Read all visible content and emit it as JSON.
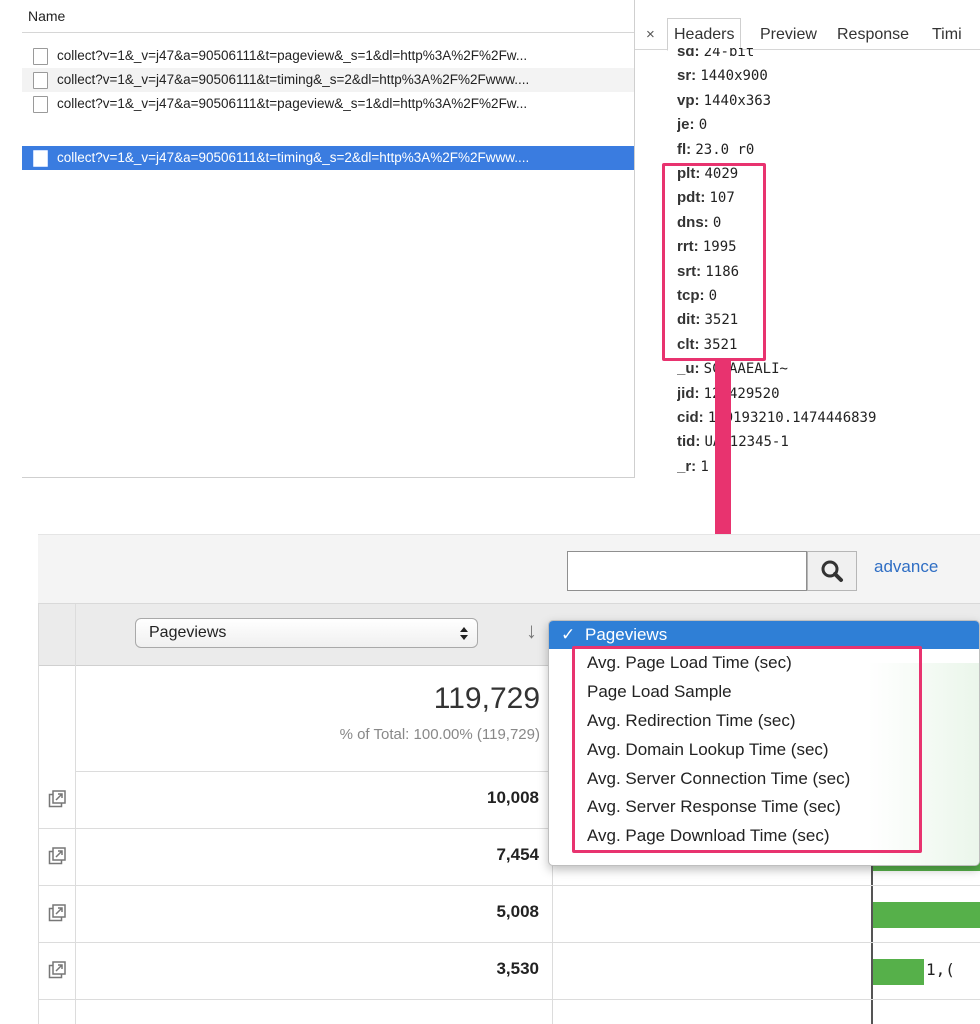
{
  "devtools": {
    "list_header": "Name",
    "requests": [
      {
        "name": "collect?v=1&_v=j47&a=90506111&t=pageview&_s=1&dl=http%3A%2F%2Fw..."
      },
      {
        "name": "collect?v=1&_v=j47&a=90506111&t=timing&_s=2&dl=http%3A%2F%2Fwww...."
      },
      {
        "name": "collect?v=1&_v=j47&a=90506111&t=pageview&_s=1&dl=http%3A%2F%2Fw..."
      },
      {
        "name": "collect?v=1&_v=j47&a=90506111&t=timing&_s=2&dl=http%3A%2F%2Fwww...."
      }
    ],
    "selected_request_index": 3,
    "tabs": {
      "close": "×",
      "headers": "Headers",
      "preview": "Preview",
      "response": "Response",
      "timing": "Timi"
    },
    "params": [
      {
        "key": "sd:",
        "value": "24-bit"
      },
      {
        "key": "sr:",
        "value": "1440x900"
      },
      {
        "key": "vp:",
        "value": "1440x363"
      },
      {
        "key": "je:",
        "value": "0"
      },
      {
        "key": "fl:",
        "value": "23.0 r0"
      },
      {
        "key": "plt:",
        "value": "4029"
      },
      {
        "key": "pdt:",
        "value": "107"
      },
      {
        "key": "dns:",
        "value": "0"
      },
      {
        "key": "rrt:",
        "value": "1995"
      },
      {
        "key": "srt:",
        "value": "1186"
      },
      {
        "key": "tcp:",
        "value": "0"
      },
      {
        "key": "dit:",
        "value": "3521"
      },
      {
        "key": "clt:",
        "value": "3521"
      },
      {
        "key": "_u:",
        "value": "SCCAAEALI~"
      },
      {
        "key": "jid:",
        "value": "128429520"
      },
      {
        "key": "cid:",
        "value": "199193210.1474446839"
      },
      {
        "key": "tid:",
        "value": "UA-12345-1"
      },
      {
        "key": "_r:",
        "value": "1"
      }
    ]
  },
  "ga": {
    "search": {
      "placeholder": "",
      "value": ""
    },
    "advanced_link": "advance",
    "metric_select": {
      "value": "Pageviews"
    },
    "total": {
      "value": "119,729",
      "pct": "% of Total: 100.00% (119,729)"
    },
    "rows": [
      {
        "value": "10,008",
        "bar_fraction": 1.0,
        "bar_label": ""
      },
      {
        "value": "7,454",
        "bar_fraction": 1.0,
        "bar_label": ""
      },
      {
        "value": "5,008",
        "bar_fraction": 1.0,
        "bar_label": ""
      },
      {
        "value": "3,530",
        "bar_fraction": 0.47,
        "bar_label": "1,("
      }
    ],
    "dropdown": {
      "selected": "Pageviews",
      "check": "✓",
      "options": [
        "Avg. Page Load Time (sec)",
        "Page Load Sample",
        "Avg. Redirection Time (sec)",
        "Avg. Domain Lookup Time (sec)",
        "Avg. Server Connection Time (sec)",
        "Avg. Server Response Time (sec)",
        "Avg. Page Download Time (sec)"
      ]
    }
  },
  "colors": {
    "highlight": "#e8336f",
    "selection_blue": "#3a7ce0",
    "bar_green": "#56b04a",
    "link_blue": "#2f6ec4"
  },
  "icons": {
    "search": "search-icon",
    "external_link": "external-link-icon",
    "close": "close-icon",
    "sort_down": "sort-down-arrow-icon",
    "select_stepper": "select-stepper-icon",
    "checkmark": "checkmark-icon",
    "annotation_arrow": "down-arrow-annotation"
  }
}
